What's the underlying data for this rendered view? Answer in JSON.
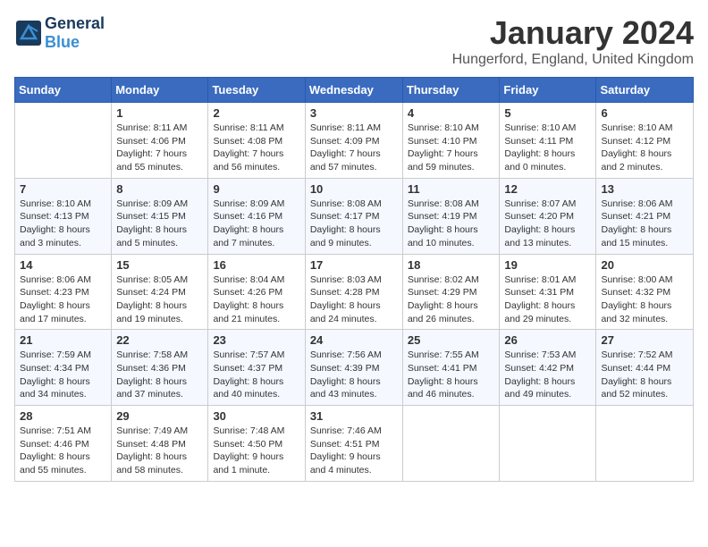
{
  "header": {
    "logo_general": "General",
    "logo_blue": "Blue",
    "title": "January 2024",
    "subtitle": "Hungerford, England, United Kingdom"
  },
  "columns": [
    "Sunday",
    "Monday",
    "Tuesday",
    "Wednesday",
    "Thursday",
    "Friday",
    "Saturday"
  ],
  "weeks": [
    [
      {
        "day": "",
        "content": ""
      },
      {
        "day": "1",
        "content": "Sunrise: 8:11 AM\nSunset: 4:06 PM\nDaylight: 7 hours\nand 55 minutes."
      },
      {
        "day": "2",
        "content": "Sunrise: 8:11 AM\nSunset: 4:08 PM\nDaylight: 7 hours\nand 56 minutes."
      },
      {
        "day": "3",
        "content": "Sunrise: 8:11 AM\nSunset: 4:09 PM\nDaylight: 7 hours\nand 57 minutes."
      },
      {
        "day": "4",
        "content": "Sunrise: 8:10 AM\nSunset: 4:10 PM\nDaylight: 7 hours\nand 59 minutes."
      },
      {
        "day": "5",
        "content": "Sunrise: 8:10 AM\nSunset: 4:11 PM\nDaylight: 8 hours\nand 0 minutes."
      },
      {
        "day": "6",
        "content": "Sunrise: 8:10 AM\nSunset: 4:12 PM\nDaylight: 8 hours\nand 2 minutes."
      }
    ],
    [
      {
        "day": "7",
        "content": "Sunrise: 8:10 AM\nSunset: 4:13 PM\nDaylight: 8 hours\nand 3 minutes."
      },
      {
        "day": "8",
        "content": "Sunrise: 8:09 AM\nSunset: 4:15 PM\nDaylight: 8 hours\nand 5 minutes."
      },
      {
        "day": "9",
        "content": "Sunrise: 8:09 AM\nSunset: 4:16 PM\nDaylight: 8 hours\nand 7 minutes."
      },
      {
        "day": "10",
        "content": "Sunrise: 8:08 AM\nSunset: 4:17 PM\nDaylight: 8 hours\nand 9 minutes."
      },
      {
        "day": "11",
        "content": "Sunrise: 8:08 AM\nSunset: 4:19 PM\nDaylight: 8 hours\nand 10 minutes."
      },
      {
        "day": "12",
        "content": "Sunrise: 8:07 AM\nSunset: 4:20 PM\nDaylight: 8 hours\nand 13 minutes."
      },
      {
        "day": "13",
        "content": "Sunrise: 8:06 AM\nSunset: 4:21 PM\nDaylight: 8 hours\nand 15 minutes."
      }
    ],
    [
      {
        "day": "14",
        "content": "Sunrise: 8:06 AM\nSunset: 4:23 PM\nDaylight: 8 hours\nand 17 minutes."
      },
      {
        "day": "15",
        "content": "Sunrise: 8:05 AM\nSunset: 4:24 PM\nDaylight: 8 hours\nand 19 minutes."
      },
      {
        "day": "16",
        "content": "Sunrise: 8:04 AM\nSunset: 4:26 PM\nDaylight: 8 hours\nand 21 minutes."
      },
      {
        "day": "17",
        "content": "Sunrise: 8:03 AM\nSunset: 4:28 PM\nDaylight: 8 hours\nand 24 minutes."
      },
      {
        "day": "18",
        "content": "Sunrise: 8:02 AM\nSunset: 4:29 PM\nDaylight: 8 hours\nand 26 minutes."
      },
      {
        "day": "19",
        "content": "Sunrise: 8:01 AM\nSunset: 4:31 PM\nDaylight: 8 hours\nand 29 minutes."
      },
      {
        "day": "20",
        "content": "Sunrise: 8:00 AM\nSunset: 4:32 PM\nDaylight: 8 hours\nand 32 minutes."
      }
    ],
    [
      {
        "day": "21",
        "content": "Sunrise: 7:59 AM\nSunset: 4:34 PM\nDaylight: 8 hours\nand 34 minutes."
      },
      {
        "day": "22",
        "content": "Sunrise: 7:58 AM\nSunset: 4:36 PM\nDaylight: 8 hours\nand 37 minutes."
      },
      {
        "day": "23",
        "content": "Sunrise: 7:57 AM\nSunset: 4:37 PM\nDaylight: 8 hours\nand 40 minutes."
      },
      {
        "day": "24",
        "content": "Sunrise: 7:56 AM\nSunset: 4:39 PM\nDaylight: 8 hours\nand 43 minutes."
      },
      {
        "day": "25",
        "content": "Sunrise: 7:55 AM\nSunset: 4:41 PM\nDaylight: 8 hours\nand 46 minutes."
      },
      {
        "day": "26",
        "content": "Sunrise: 7:53 AM\nSunset: 4:42 PM\nDaylight: 8 hours\nand 49 minutes."
      },
      {
        "day": "27",
        "content": "Sunrise: 7:52 AM\nSunset: 4:44 PM\nDaylight: 8 hours\nand 52 minutes."
      }
    ],
    [
      {
        "day": "28",
        "content": "Sunrise: 7:51 AM\nSunset: 4:46 PM\nDaylight: 8 hours\nand 55 minutes."
      },
      {
        "day": "29",
        "content": "Sunrise: 7:49 AM\nSunset: 4:48 PM\nDaylight: 8 hours\nand 58 minutes."
      },
      {
        "day": "30",
        "content": "Sunrise: 7:48 AM\nSunset: 4:50 PM\nDaylight: 9 hours\nand 1 minute."
      },
      {
        "day": "31",
        "content": "Sunrise: 7:46 AM\nSunset: 4:51 PM\nDaylight: 9 hours\nand 4 minutes."
      },
      {
        "day": "",
        "content": ""
      },
      {
        "day": "",
        "content": ""
      },
      {
        "day": "",
        "content": ""
      }
    ]
  ]
}
